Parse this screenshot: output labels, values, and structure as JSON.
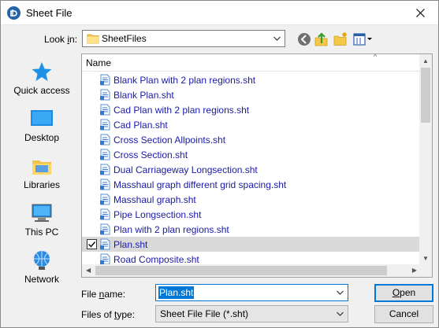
{
  "window": {
    "title": "Sheet File"
  },
  "lookin": {
    "label_prefix": "Look ",
    "label_hotkey": "i",
    "label_suffix": "n:",
    "value": "SheetFiles"
  },
  "toolbar": {
    "back_icon": "back-arrow-icon",
    "up_icon": "up-folder-icon",
    "new_folder_icon": "new-folder-icon",
    "view_icon": "view-menu-icon"
  },
  "places": [
    {
      "label": "Quick access",
      "icon": "star-icon"
    },
    {
      "label": "Desktop",
      "icon": "desktop-icon"
    },
    {
      "label": "Libraries",
      "icon": "libraries-icon"
    },
    {
      "label": "This PC",
      "icon": "computer-icon"
    },
    {
      "label": "Network",
      "icon": "network-icon"
    }
  ],
  "filelist": {
    "column_name": "Name",
    "files": [
      {
        "name": "Blank Plan with 2 plan regions.sht",
        "selected": false
      },
      {
        "name": "Blank Plan.sht",
        "selected": false
      },
      {
        "name": "Cad Plan with 2 plan regions.sht",
        "selected": false
      },
      {
        "name": "Cad Plan.sht",
        "selected": false
      },
      {
        "name": "Cross Section Allpoints.sht",
        "selected": false
      },
      {
        "name": "Cross Section.sht",
        "selected": false
      },
      {
        "name": "Dual Carriageway Longsection.sht",
        "selected": false
      },
      {
        "name": "Masshaul graph different grid spacing.sht",
        "selected": false
      },
      {
        "name": "Masshaul graph.sht",
        "selected": false
      },
      {
        "name": "Pipe Longsection.sht",
        "selected": false
      },
      {
        "name": "Plan with 2 plan regions.sht",
        "selected": false
      },
      {
        "name": "Plan.sht",
        "selected": true
      },
      {
        "name": "Road Composite.sht",
        "selected": false
      }
    ]
  },
  "filename": {
    "label_prefix": "File ",
    "label_hotkey": "n",
    "label_suffix": "ame:",
    "value": "Plan.sht"
  },
  "filetype": {
    "label_prefix": "Files of ",
    "label_hotkey": "t",
    "label_suffix": "ype:",
    "value": "Sheet File File (*.sht)"
  },
  "buttons": {
    "open_hotkey": "O",
    "open_rest": "pen",
    "cancel": "Cancel"
  },
  "colors": {
    "accent": "#0078d7",
    "file_text": "#1a1aa6",
    "selected_row": "#d9d9d9"
  }
}
